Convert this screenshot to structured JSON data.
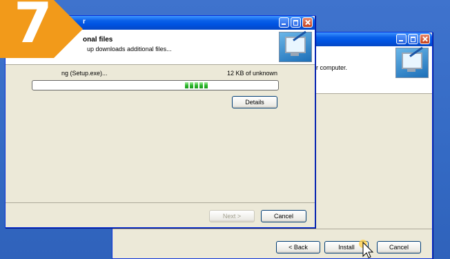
{
  "badge": {
    "number": "7",
    "color": "#f29a1a"
  },
  "back_window": {
    "header_text": "r computer.",
    "buttons": {
      "back": "< Back",
      "install": "Install",
      "cancel": "Cancel"
    }
  },
  "front_window": {
    "title": "r",
    "header_title": "onal files",
    "header_subtitle": "up downloads additional files...",
    "status_text": "ng (Setup.exe)...",
    "size_text": "12 KB of unknown",
    "progress_percent": 72,
    "buttons": {
      "details": "Details",
      "next": "Next >",
      "cancel": "Cancel"
    }
  },
  "icons": [
    "setup-monitor-icon",
    "minimize-icon",
    "maximize-icon",
    "close-icon",
    "mouse-pointer-icon"
  ]
}
